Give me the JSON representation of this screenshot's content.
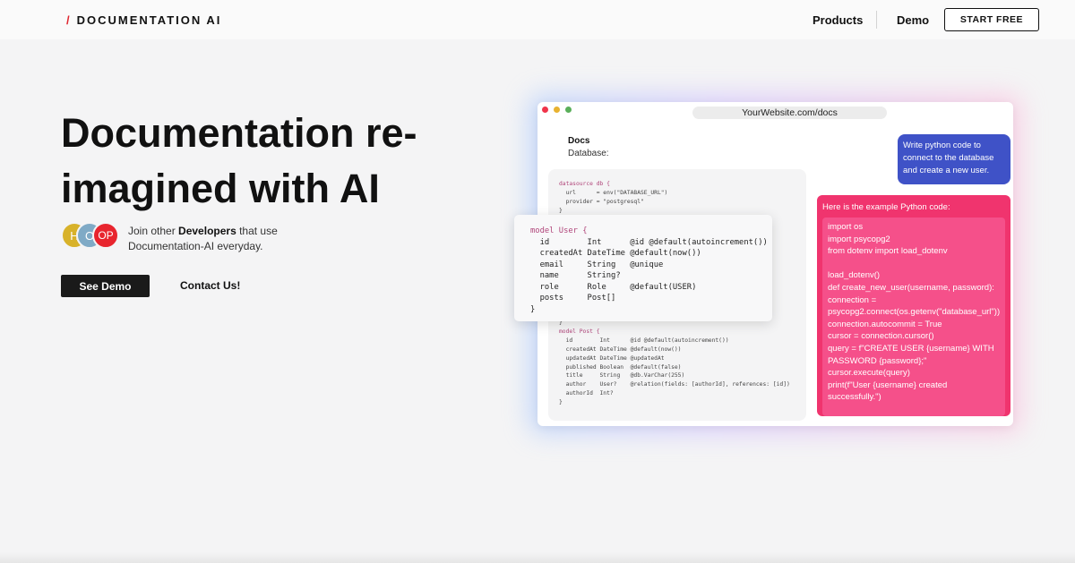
{
  "header": {
    "brand_slash": "/",
    "brand_name": "DOCUMENTATION AI",
    "nav": [
      "Products",
      "Demo"
    ],
    "cta": "START FREE"
  },
  "hero": {
    "title": "Documentation re-imagined with AI",
    "avatars": [
      {
        "text": "H",
        "color": "#d8b22a"
      },
      {
        "text": "O",
        "color": "#7faac6"
      },
      {
        "text": "OP",
        "color": "#e8252e"
      }
    ],
    "join_prefix": "Join other ",
    "join_bold": "Developers",
    "join_suffix": " that use Documentation-AI everyday.",
    "primary_button": "See Demo",
    "secondary_button": "Contact Us!"
  },
  "mock": {
    "window_dots": [
      "#f0344a",
      "#e8b230",
      "#5aaf5a"
    ],
    "url": "YourWebsite.com/docs",
    "docs_label": "Docs",
    "database_label": "Database:",
    "schema_top": [
      "datasource db {",
      "  url      = env(\"DATABASE_URL\")",
      "  provider = \"postgresql\"",
      "}"
    ],
    "schema_bottom": [
      "}",
      "",
      "model Post {",
      "  id        Int      @id @default(autoincrement())",
      "  createdAt DateTime @default(now())",
      "  updatedAt DateTime @updatedAt",
      "  published Boolean  @default(false)",
      "  title     String   @db.VarChar(255)",
      "  author    User?    @relation(fields: [authorId], references: [id])",
      "  authorId  Int?",
      "}"
    ],
    "model_user": [
      "model User {",
      "  id        Int      @id @default(autoincrement())",
      "  createdAt DateTime @default(now())",
      "  email     String   @unique",
      "  name      String?",
      "  role      Role     @default(USER)",
      "  posts     Post[]",
      "}"
    ],
    "user_prompt": "Write python code to connect to the database and create a new user.",
    "bot_title": "Here is the example Python code:",
    "bot_code": [
      "import os",
      "import psycopg2",
      "from dotenv import load_dotenv",
      "",
      "load_dotenv()",
      "def create_new_user(username, password):",
      "connection =",
      "psycopg2.connect(os.getenv(\"database_url\"))",
      "connection.autocommit = True",
      "cursor = connection.cursor()",
      "query = f\"CREATE USER {username} WITH PASSWORD {password};\"",
      "cursor.execute(query)",
      "print(f\"User {username} created successfully.\")"
    ]
  }
}
